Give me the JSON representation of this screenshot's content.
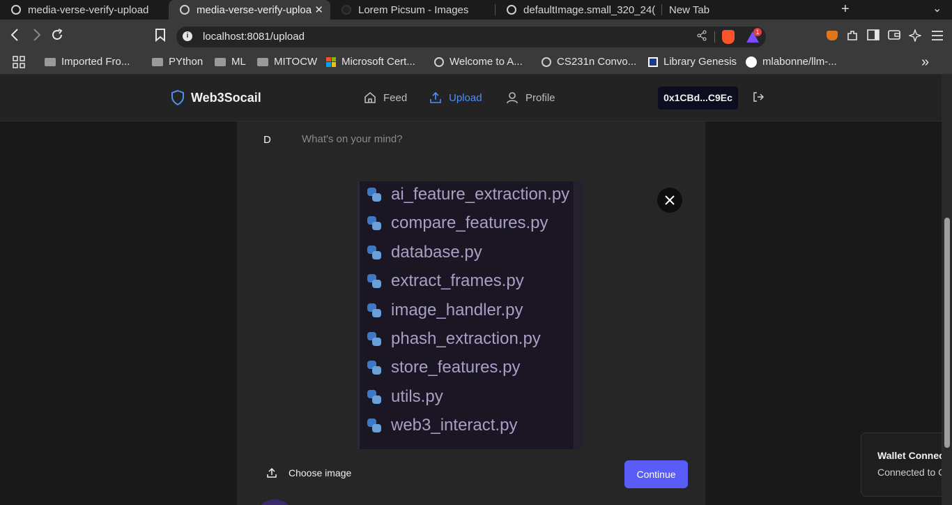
{
  "browser": {
    "tabs": [
      {
        "title": "media-verse-verify-upload",
        "active": false
      },
      {
        "title": "media-verse-verify-uploa",
        "active": true
      },
      {
        "title": "Lorem Picsum - Images",
        "active": false
      },
      {
        "title": "defaultImage.small_320_24(",
        "active": false
      },
      {
        "title": "New Tab",
        "active": false
      }
    ],
    "url": "localhost:8081/upload",
    "rewards_badge": "1",
    "bookmarks": [
      {
        "label": "Imported Fro...",
        "icon": "folder-icon"
      },
      {
        "label": "PYthon",
        "icon": "folder-icon"
      },
      {
        "label": "ML",
        "icon": "folder-icon"
      },
      {
        "label": "MITOCW",
        "icon": "folder-icon"
      },
      {
        "label": "Microsoft Cert...",
        "icon": "microsoft-icon"
      },
      {
        "label": "Welcome to A...",
        "icon": "globe-icon"
      },
      {
        "label": "CS231n Convo...",
        "icon": "globe-icon"
      },
      {
        "label": "Library Genesis",
        "icon": "library-genesis-icon"
      },
      {
        "label": "mlabonne/llm-...",
        "icon": "github-icon"
      }
    ]
  },
  "app": {
    "brand": "Web3Socail",
    "nav": [
      {
        "label": "Feed",
        "icon": "home-icon",
        "active": false
      },
      {
        "label": "Upload",
        "icon": "upload-icon",
        "active": true
      },
      {
        "label": "Profile",
        "icon": "user-icon",
        "active": false
      }
    ],
    "wallet_address": "0x1CBd...C9Ec",
    "accent_color": "#4d8ef7"
  },
  "composer": {
    "avatar_initial": "D",
    "placeholder": "What's on your mind?",
    "preview_files": [
      "ai_feature_extraction.py",
      "compare_features.py",
      "database.py",
      "extract_frames.py",
      "image_handler.py",
      "phash_extraction.py",
      "store_features.py",
      "utils.py",
      "web3_interact.py"
    ],
    "choose_label": "Choose image",
    "continue_label": "Continue",
    "continue_color": "#5a5cf6"
  },
  "toast": {
    "title": "Wallet Connec",
    "body": "Connected to C"
  }
}
